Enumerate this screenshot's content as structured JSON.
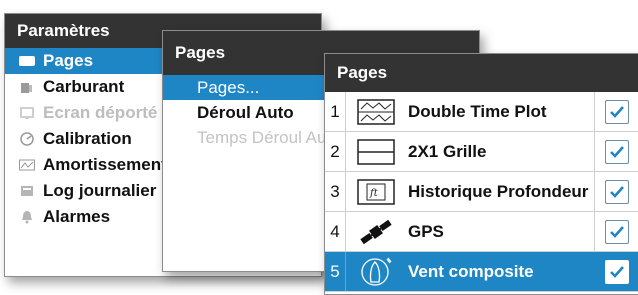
{
  "parametres": {
    "title": "Paramètres",
    "items": [
      {
        "label": "Pages",
        "icon": "pages-icon",
        "state": "selected"
      },
      {
        "label": "Carburant",
        "icon": "fuel-icon",
        "state": "normal"
      },
      {
        "label": "Ecran déporté",
        "icon": "remote-display-icon",
        "state": "disabled"
      },
      {
        "label": "Calibration",
        "icon": "calibration-icon",
        "state": "normal"
      },
      {
        "label": "Amortissement",
        "icon": "damping-icon",
        "state": "normal"
      },
      {
        "label": "Log journalier",
        "icon": "log-icon",
        "state": "normal"
      },
      {
        "label": "Alarmes",
        "icon": "alarm-bell-icon",
        "state": "normal"
      }
    ]
  },
  "pages_menu": {
    "title": "Pages",
    "items": [
      {
        "label": "Pages...",
        "state": "selected"
      },
      {
        "label": "Déroul Auto",
        "state": "normal"
      },
      {
        "label": "Temps Déroul Auto",
        "state": "disabled"
      }
    ]
  },
  "pages_list": {
    "title": "Pages",
    "rows": [
      {
        "num": "1",
        "label": "Double Time Plot",
        "thumb": "double-time-plot-icon",
        "checked": true
      },
      {
        "num": "2",
        "label": "2X1 Grille",
        "thumb": "grid-2x1-icon",
        "checked": true
      },
      {
        "num": "3",
        "label": "Historique Profondeur",
        "thumb": "depth-history-icon",
        "checked": true
      },
      {
        "num": "4",
        "label": "GPS",
        "thumb": "satellite-icon",
        "checked": true
      },
      {
        "num": "5",
        "label": "Vent composite",
        "thumb": "wind-boat-icon",
        "checked": true,
        "selected": true
      }
    ]
  },
  "colors": {
    "accent": "#1f86c5",
    "header": "#333333"
  }
}
